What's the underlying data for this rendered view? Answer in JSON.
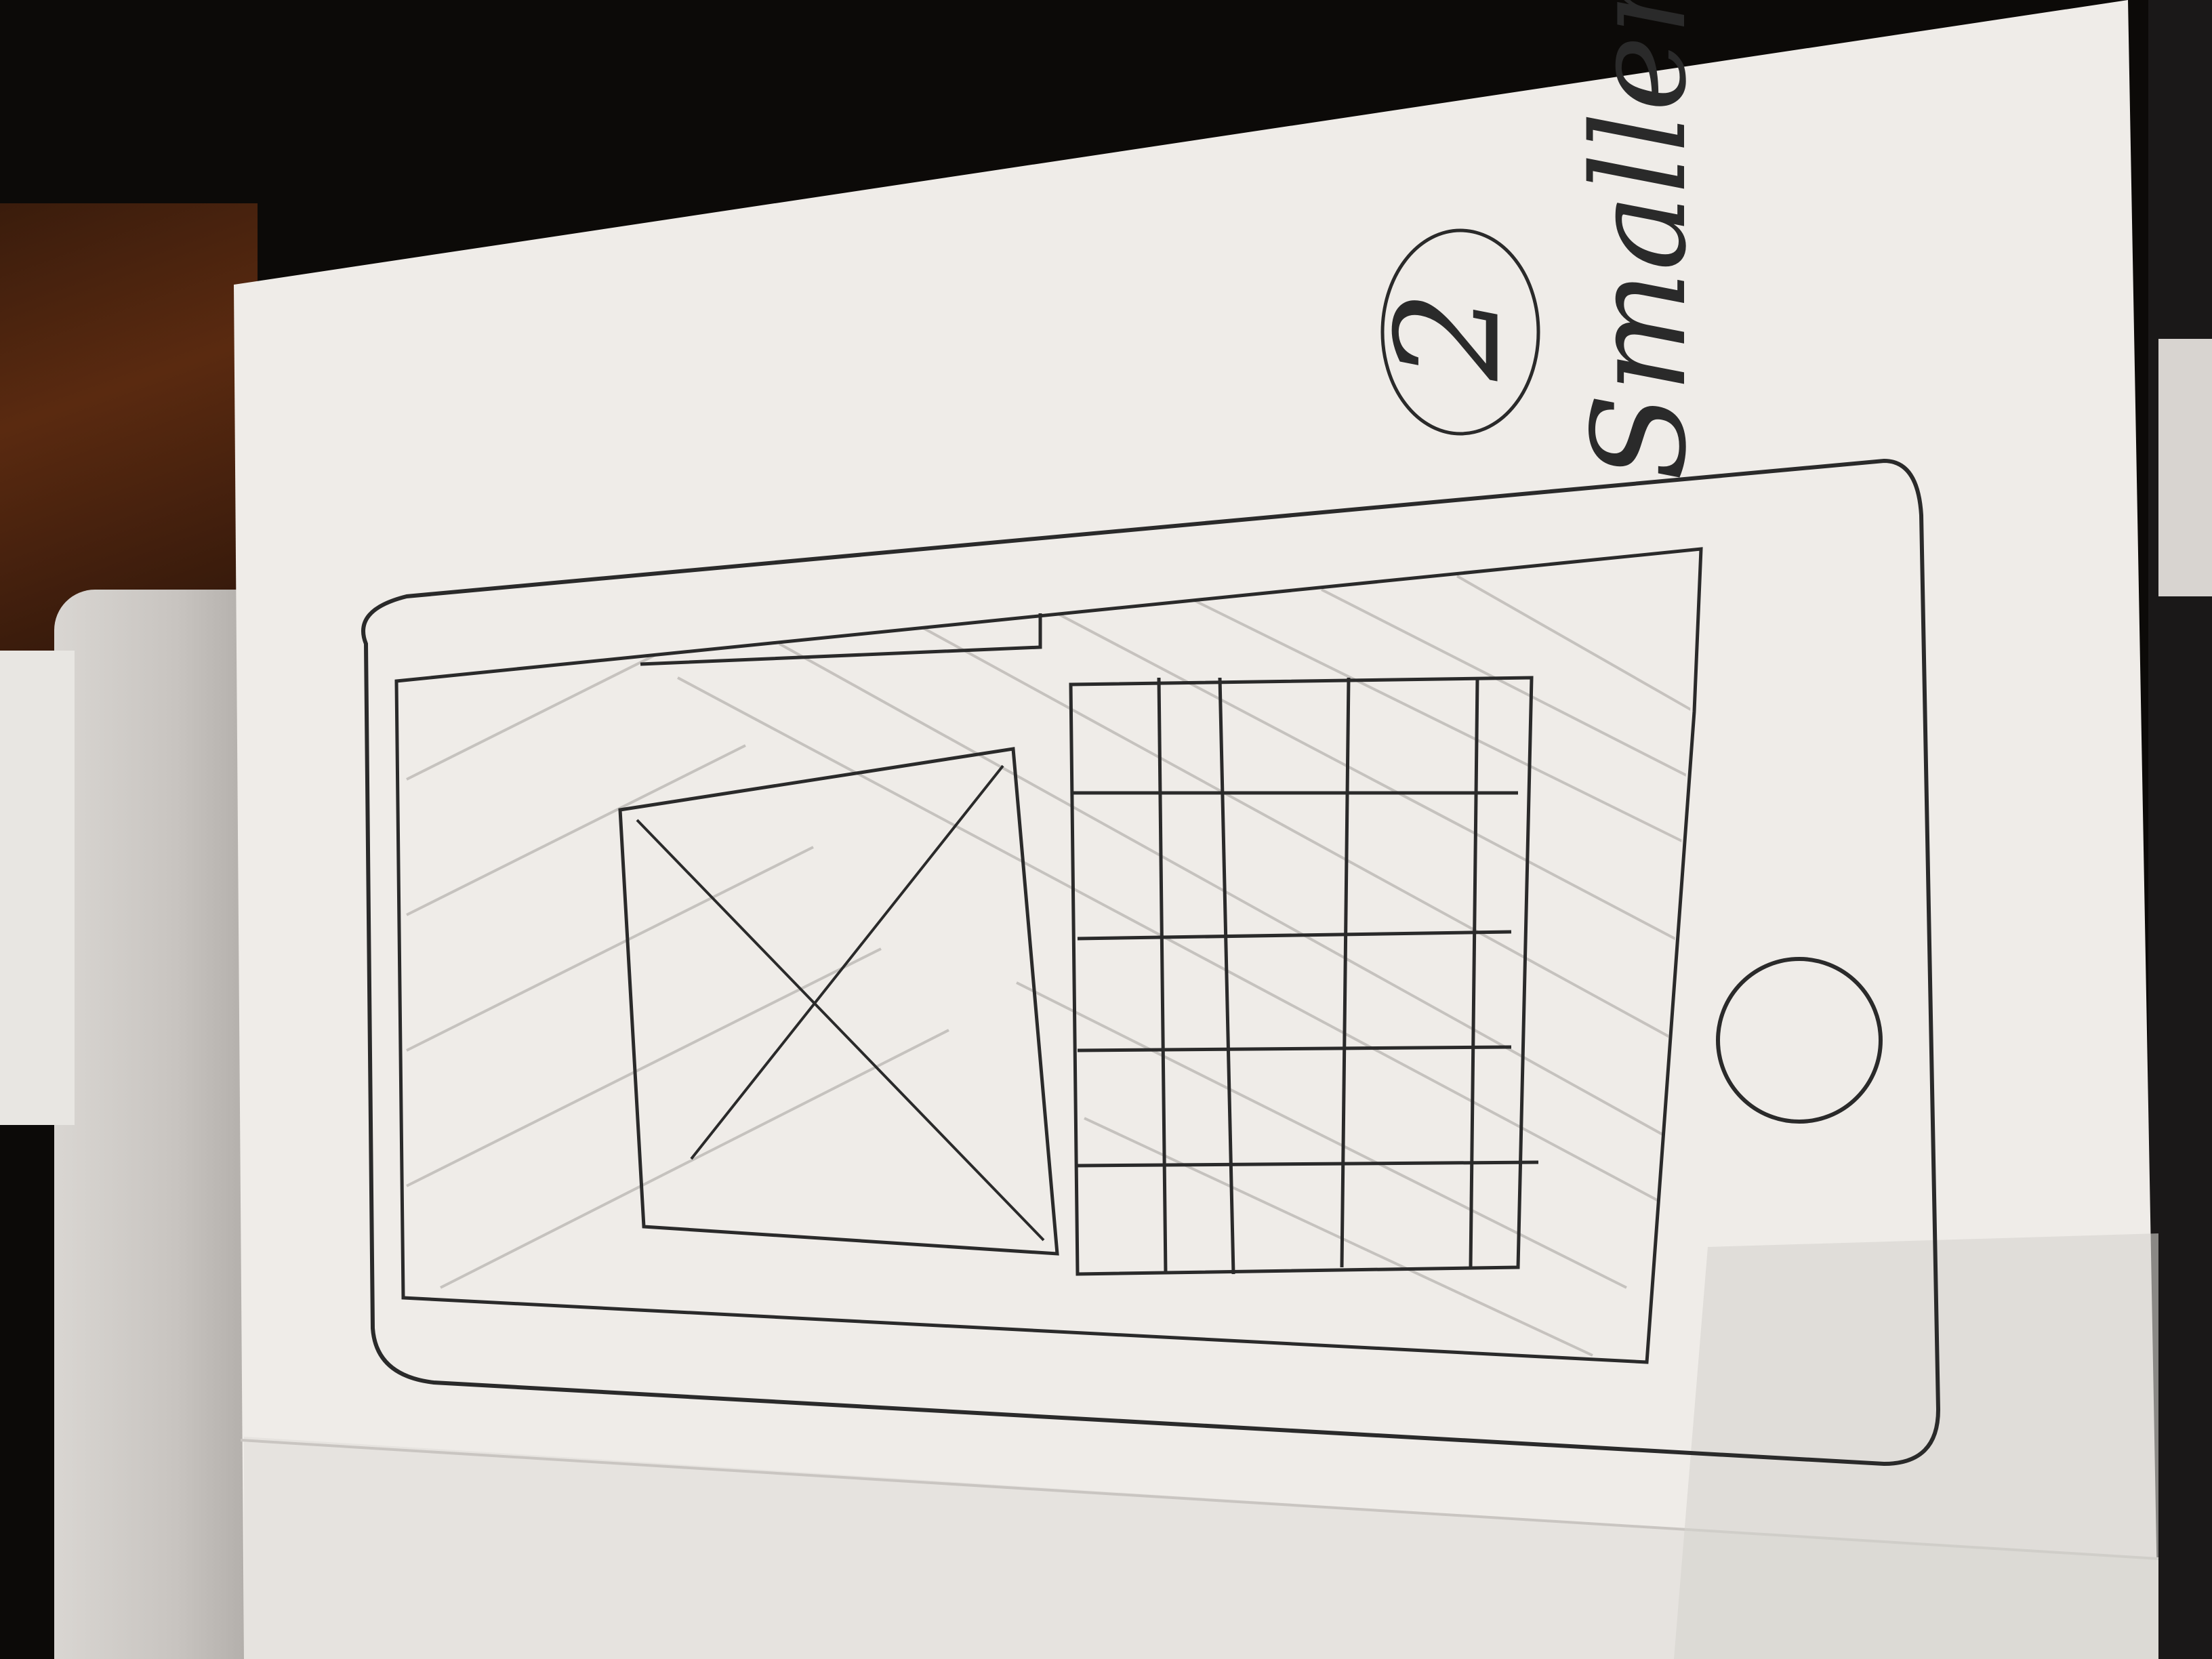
{
  "sketch": {
    "annotation_number": "2",
    "annotation_text": "Smaller"
  },
  "colors": {
    "paper": "#efece8",
    "ink": "#2a2a2a",
    "hatch": "#b8b4b0",
    "background": "#0c0a08"
  }
}
